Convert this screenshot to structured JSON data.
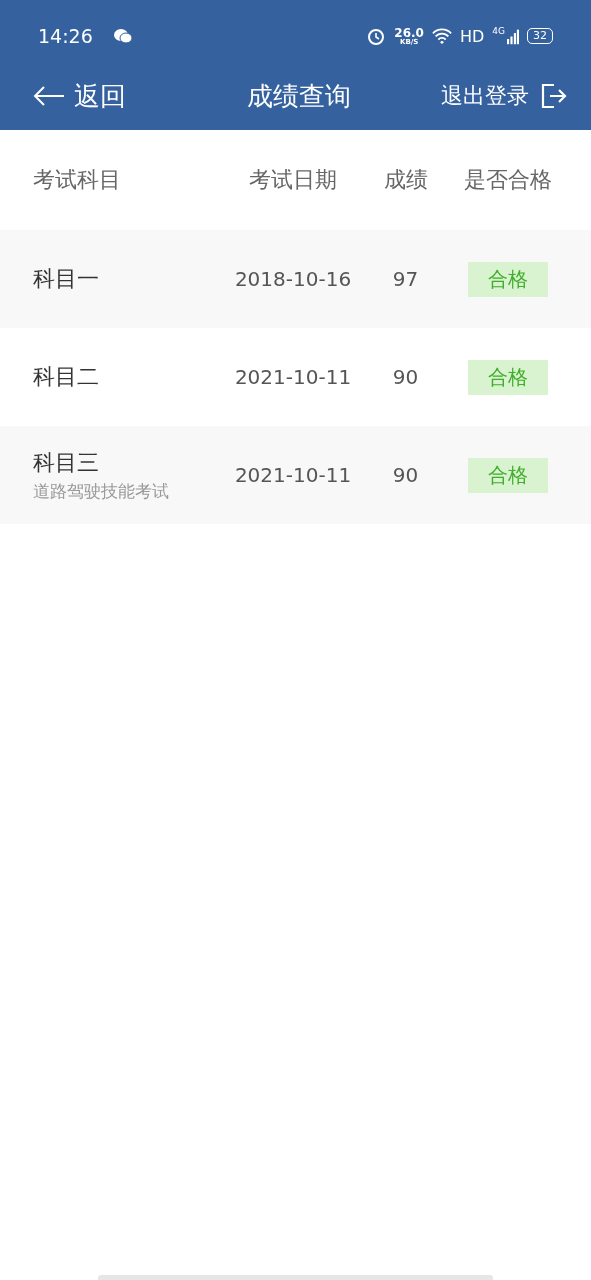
{
  "status_bar": {
    "time": "14:26",
    "speed": "26.0",
    "speed_unit": "KB/S",
    "hd": "HD",
    "network": "4G",
    "battery": "32"
  },
  "nav": {
    "back": "返回",
    "title": "成绩查询",
    "logout": "退出登录"
  },
  "table": {
    "columns": [
      "考试科目",
      "考试日期",
      "成绩",
      "是否合格"
    ],
    "rows": [
      {
        "subject": "科目一",
        "date": "2018-10-16",
        "score": "97",
        "result": "合格",
        "passed": true
      },
      {
        "subject": "科目二",
        "date": "2021-10-11",
        "score": "90",
        "result": "合格",
        "passed": true
      },
      {
        "subject": "科目三",
        "subtitle": "道路驾驶技能考试",
        "date": "2021-10-11",
        "score": "90",
        "result": "合格",
        "passed": true
      }
    ]
  }
}
